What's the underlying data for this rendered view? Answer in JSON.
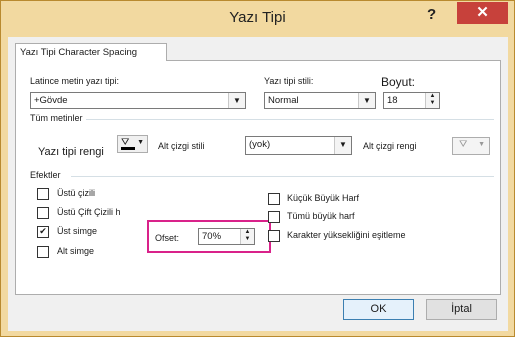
{
  "window": {
    "title": "Yazı Tipi",
    "help_glyph": "?",
    "close_glyph": "✕"
  },
  "tabs": [
    {
      "label": "Yazı Tipi Character Spacing"
    }
  ],
  "latin_font": {
    "label": "Latince metin yazı tipi:",
    "value": "+Gövde"
  },
  "font_style": {
    "label": "Yazı tipi stili:",
    "value": "Normal"
  },
  "size": {
    "label": "Boyut:",
    "value": "18"
  },
  "all_text": {
    "group_label": "Tüm metinler",
    "font_color_label": "Yazı tipi rengi",
    "underline_style_label": "Alt çizgi stili",
    "underline_style_value": "(yok)",
    "underline_color_label": "Alt çizgi rengi"
  },
  "effects": {
    "group_label": "Efektler",
    "strikethrough": {
      "label": "Üstü çizili",
      "checked": false
    },
    "double_strikethrough": {
      "label": "Üstü Çift Çizili h",
      "checked": false
    },
    "superscript": {
      "label": "Üst simge",
      "checked": true
    },
    "subscript": {
      "label": "Alt simge",
      "checked": false
    },
    "offset": {
      "label": "Ofset:",
      "value": "70%"
    },
    "small_caps": {
      "label": "Küçük Büyük Harf",
      "checked": false
    },
    "all_caps": {
      "label": "Tümü büyük harf",
      "checked": false
    },
    "equalize_height": {
      "label": "Karakter yüksekliğini eşitleme",
      "checked": false
    }
  },
  "buttons": {
    "ok": "OK",
    "cancel": "İptal"
  },
  "icons": {
    "dropdown": "chevron-down-icon",
    "paint_bucket": "paint-bucket-icon"
  },
  "colors": {
    "highlight": "#d9228a",
    "frame": "#f2d9a0",
    "close": "#c7413b"
  }
}
